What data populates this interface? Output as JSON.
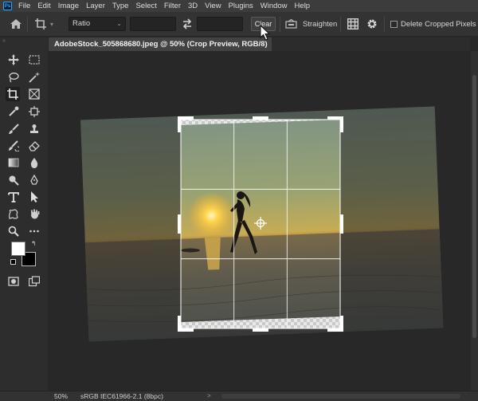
{
  "app": {
    "logo": "Ps"
  },
  "menu": [
    "File",
    "Edit",
    "Image",
    "Layer",
    "Type",
    "Select",
    "Filter",
    "3D",
    "View",
    "Plugins",
    "Window",
    "Help"
  ],
  "options_bar": {
    "ratio_value": "Ratio",
    "width_value": "",
    "height_value": "",
    "clear_label": "Clear",
    "straighten_label": "Straighten",
    "delete_cropped_label": "Delete Cropped Pixels",
    "delete_cropped_checked": false
  },
  "document": {
    "tab_title": "AdobeStock_505868680.jpeg @ 50% (Crop Preview, RGB/8)",
    "close_glyph": "×"
  },
  "status": {
    "zoom": "50%",
    "color_profile": "sRGB IEC61966-2.1 (8bpc)",
    "arrow": ">"
  },
  "colors": {
    "accent": "#31a8ff",
    "panel": "#333333",
    "canvas": "#282828"
  }
}
